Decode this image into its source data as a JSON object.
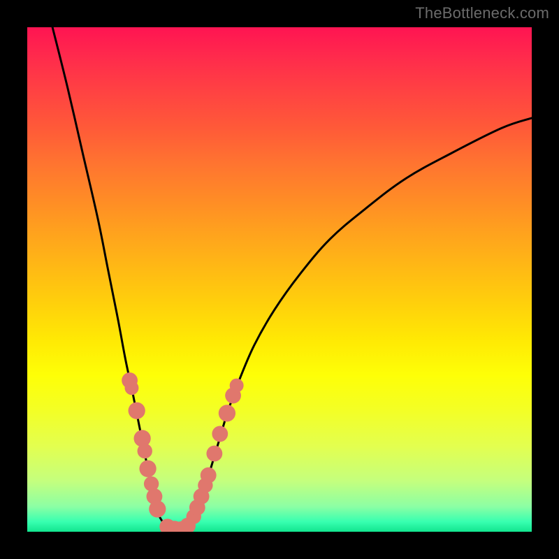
{
  "watermark": "TheBottleneck.com",
  "colors": {
    "frame": "#000000",
    "curve": "#000000",
    "marker": "#e0776d"
  },
  "chart_data": {
    "type": "line",
    "title": "",
    "xlabel": "",
    "ylabel": "",
    "xlim": [
      0,
      100
    ],
    "ylim": [
      0,
      100
    ],
    "grid": false,
    "legend": false,
    "series": [
      {
        "name": "left-curve",
        "x": [
          5,
          8,
          11,
          14,
          16,
          18,
          19.5,
          21,
          22.2,
          23.2,
          24,
          24.8,
          25.5,
          26.2,
          28,
          30
        ],
        "values": [
          100,
          88,
          75,
          62,
          52,
          42,
          34,
          27,
          21,
          16,
          12,
          8.5,
          5.5,
          3,
          0.8,
          0.5
        ]
      },
      {
        "name": "right-curve",
        "x": [
          30,
          32,
          33.5,
          35,
          36.5,
          38,
          39.8,
          42,
          45,
          49,
          54,
          60,
          67,
          75,
          84,
          94,
          100
        ],
        "values": [
          0.5,
          1.5,
          4,
          8,
          13,
          18,
          24,
          30,
          37,
          44,
          51,
          58,
          64,
          70,
          75,
          80,
          82
        ]
      }
    ],
    "markers": {
      "left_cluster": [
        {
          "x": 20.3,
          "y": 30,
          "r": 1.0
        },
        {
          "x": 20.7,
          "y": 28.5,
          "r": 0.8
        },
        {
          "x": 21.7,
          "y": 24,
          "r": 1.1
        },
        {
          "x": 22.8,
          "y": 18.5,
          "r": 1.1
        },
        {
          "x": 23.3,
          "y": 16,
          "r": 0.9
        },
        {
          "x": 23.9,
          "y": 12.5,
          "r": 1.1
        },
        {
          "x": 24.6,
          "y": 9.5,
          "r": 0.9
        },
        {
          "x": 25.2,
          "y": 7,
          "r": 1.0
        },
        {
          "x": 25.8,
          "y": 4.5,
          "r": 1.1
        }
      ],
      "valley_cluster": [
        {
          "x": 27.8,
          "y": 1.0,
          "r": 1.0
        },
        {
          "x": 29.2,
          "y": 0.6,
          "r": 1.0
        },
        {
          "x": 30.5,
          "y": 0.6,
          "r": 0.9
        },
        {
          "x": 31.8,
          "y": 1.2,
          "r": 1.0
        }
      ],
      "right_cluster": [
        {
          "x": 33.0,
          "y": 3.0,
          "r": 0.9
        },
        {
          "x": 33.7,
          "y": 4.8,
          "r": 1.0
        },
        {
          "x": 34.5,
          "y": 7.0,
          "r": 1.0
        },
        {
          "x": 35.3,
          "y": 9.2,
          "r": 0.9
        },
        {
          "x": 35.9,
          "y": 11.2,
          "r": 1.0
        },
        {
          "x": 37.1,
          "y": 15.5,
          "r": 1.0
        },
        {
          "x": 38.2,
          "y": 19.4,
          "r": 1.0
        },
        {
          "x": 39.6,
          "y": 23.5,
          "r": 1.1
        },
        {
          "x": 40.8,
          "y": 27.0,
          "r": 1.0
        },
        {
          "x": 41.5,
          "y": 29.0,
          "r": 0.8
        }
      ]
    }
  }
}
